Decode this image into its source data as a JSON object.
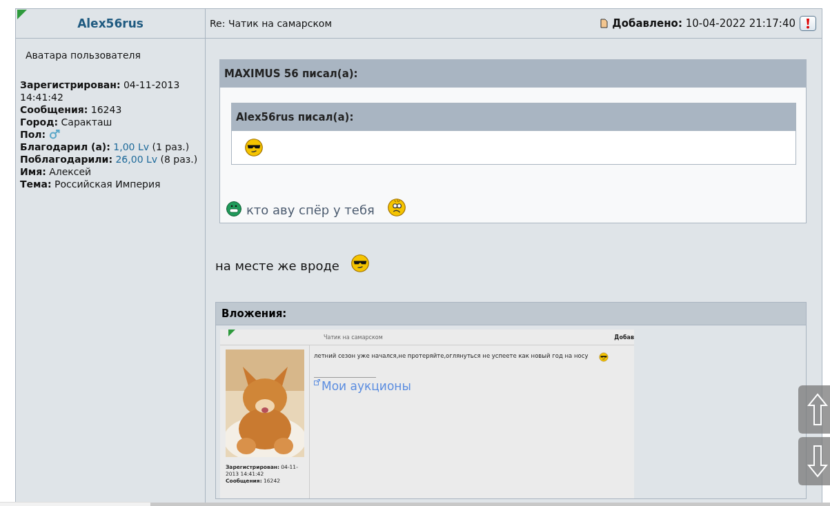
{
  "post": {
    "author": "Alex56rus",
    "title": "Re: Чатик на самарском",
    "added_label": "Добавлено:",
    "added_value": "10-04-2022 21:17:40"
  },
  "profile": {
    "avatar_alt": "Аватара пользователя",
    "fields": [
      {
        "kind": "text",
        "label": "Зарегистрирован:",
        "value": "04-11-2013 14:41:42"
      },
      {
        "kind": "text",
        "label": "Сообщения:",
        "value": "16243"
      },
      {
        "kind": "text",
        "label": "Город:",
        "value": "Саракташ"
      },
      {
        "kind": "gender",
        "label": "Пол:"
      },
      {
        "kind": "thanks",
        "label": "Благодарил (а):",
        "link": "1,00 Lv",
        "value": "(1 раз.)"
      },
      {
        "kind": "thanks",
        "label": "Поблагодарили:",
        "link": "26,00 Lv",
        "value": "(8 раз.)"
      },
      {
        "kind": "text",
        "label": "Имя:",
        "value": "Алексей"
      },
      {
        "kind": "text",
        "label": "Тема:",
        "value": "Российская Империя"
      }
    ]
  },
  "quote": {
    "author_label": "MAXIMUS 56 писал(а):",
    "nested": {
      "author_label": "Alex56rus писал(а):"
    },
    "text": "кто аву спёр у тебя"
  },
  "message": "на месте же вроде",
  "attachments": {
    "title": "Вложения:",
    "screenshot": {
      "title": "Чатик на самарском",
      "added": "Добав",
      "text": "летний сезон уже начался,не протеряйте,оглянуться не успеете как новый год на носу",
      "link": "Мои аукционы",
      "fields": [
        {
          "label": "Зарегистрирован:",
          "value": "04-11-2013 14:41:42"
        },
        {
          "label": "Сообщения:",
          "value": "16242"
        }
      ]
    }
  }
}
